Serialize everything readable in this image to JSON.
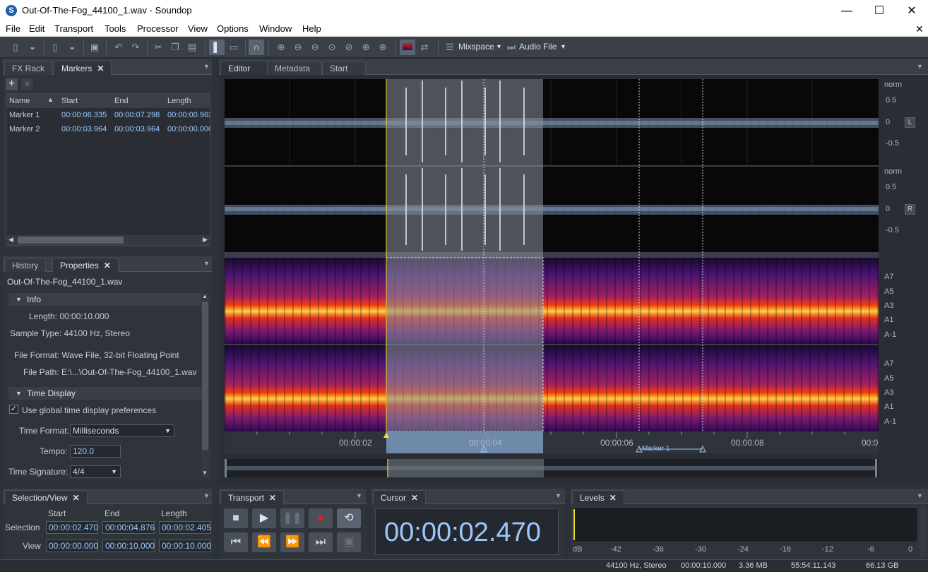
{
  "app": {
    "title": "Out-Of-The-Fog_44100_1.wav - Soundop",
    "logo": "S"
  },
  "window_controls": {
    "minimize": "—",
    "maximize": "☐",
    "close": "✕"
  },
  "menu": [
    "File",
    "Edit",
    "Transport",
    "Tools",
    "Processor",
    "View",
    "Options",
    "Window",
    "Help"
  ],
  "toolbar": {
    "mixspace_label": "Mixspace",
    "audiofile_label": "Audio File"
  },
  "left_top": {
    "tabs": [
      "FX Rack",
      "Markers"
    ],
    "add_icon": "+",
    "remove_icon": "✕",
    "columns": [
      "Name",
      "Start",
      "End",
      "Length"
    ],
    "rows": [
      {
        "name": "Marker 1",
        "start": "00:00:06.335",
        "end": "00:00:07.298",
        "length": "00:00:00.963"
      },
      {
        "name": "Marker 2",
        "start": "00:00:03.964",
        "end": "00:00:03.964",
        "length": "00:00:00.000"
      }
    ]
  },
  "left_bottom": {
    "tabs": [
      "History",
      "Properties"
    ],
    "filename": "Out-Of-The-Fog_44100_1.wav",
    "info_header": "Info",
    "length": "Length: 00:00:10.000",
    "sample_type": "Sample Type: 44100 Hz, Stereo",
    "file_format": "File Format: Wave File, 32-bit Floating Point",
    "file_path": "File Path: E:\\...\\Out-Of-The-Fog_44100_1.wav",
    "time_display_header": "Time Display",
    "use_global": "Use global time display preferences",
    "time_format_label": "Time Format:",
    "time_format_value": "Milliseconds",
    "tempo_label": "Tempo:",
    "tempo_value": "120.0",
    "time_sig_label": "Time Signature:",
    "time_sig_value": "4/4"
  },
  "editor": {
    "tabs": [
      "Editor",
      "Metadata",
      "Start"
    ],
    "amp_labels": [
      "norm",
      "0.5",
      "0",
      "-0.5"
    ],
    "channel_L": "L",
    "channel_R": "R",
    "note_labels": [
      "A7",
      "A5",
      "A3",
      "A1",
      "A-1"
    ],
    "ruler": [
      "00:00:02",
      "00:00:04",
      "00:00:06",
      "00:00:08",
      "00:0"
    ],
    "markers": [
      "Marker 2",
      "Marker 1"
    ]
  },
  "selection_view": {
    "tab": "Selection/View",
    "headers": [
      "Start",
      "End",
      "Length"
    ],
    "selection_label": "Selection",
    "view_label": "View",
    "selection": [
      "00:00:02.470",
      "00:00:04.876",
      "00:00:02.405"
    ],
    "view": [
      "00:00:00.000",
      "00:00:10.000",
      "00:00:10.000"
    ]
  },
  "transport": {
    "tab": "Transport"
  },
  "cursor": {
    "tab": "Cursor",
    "time": "00:00:02.470"
  },
  "levels": {
    "tab": "Levels",
    "scale": [
      "dB",
      "-42",
      "-36",
      "-30",
      "-24",
      "-18",
      "-12",
      "-6",
      "0"
    ]
  },
  "status": [
    "44100 Hz, Stereo",
    "00:00:10.000",
    "3.36 MB",
    "55:54:11.143",
    "66.13 GB"
  ],
  "colors": {
    "accent": "#9cc8ff",
    "selection_overlay": "#8a929c",
    "playhead": "#f0e020",
    "waveform": "#7b8ea6"
  }
}
